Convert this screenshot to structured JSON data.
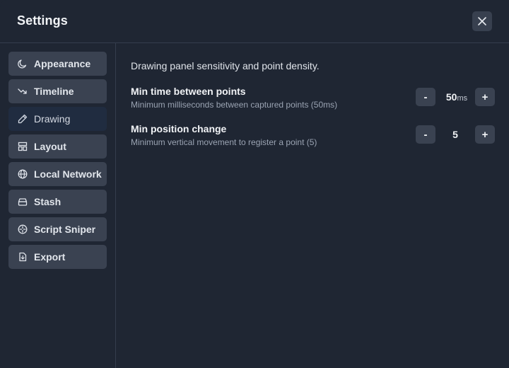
{
  "header": {
    "title": "Settings"
  },
  "sidebar": {
    "items": [
      {
        "label": "Appearance",
        "icon": "moon-icon"
      },
      {
        "label": "Timeline",
        "icon": "trend-down-icon"
      },
      {
        "label": "Drawing",
        "icon": "pencil-icon",
        "active": true
      },
      {
        "label": "Layout",
        "icon": "layout-icon"
      },
      {
        "label": "Local Network",
        "icon": "globe-icon"
      },
      {
        "label": "Stash",
        "icon": "archive-icon"
      },
      {
        "label": "Script Sniper",
        "icon": "crosshair-icon"
      },
      {
        "label": "Export",
        "icon": "file-export-icon"
      }
    ]
  },
  "content": {
    "description": "Drawing panel sensitivity and point density.",
    "settings": [
      {
        "title": "Min time between points",
        "subtitle": "Minimum milliseconds between captured points (50ms)",
        "value": "50",
        "unit": "ms",
        "decrement_label": "-",
        "increment_label": "+"
      },
      {
        "title": "Min position change",
        "subtitle": "Minimum vertical movement to register a point (5)",
        "value": "5",
        "unit": "",
        "decrement_label": "-",
        "increment_label": "+"
      }
    ]
  }
}
